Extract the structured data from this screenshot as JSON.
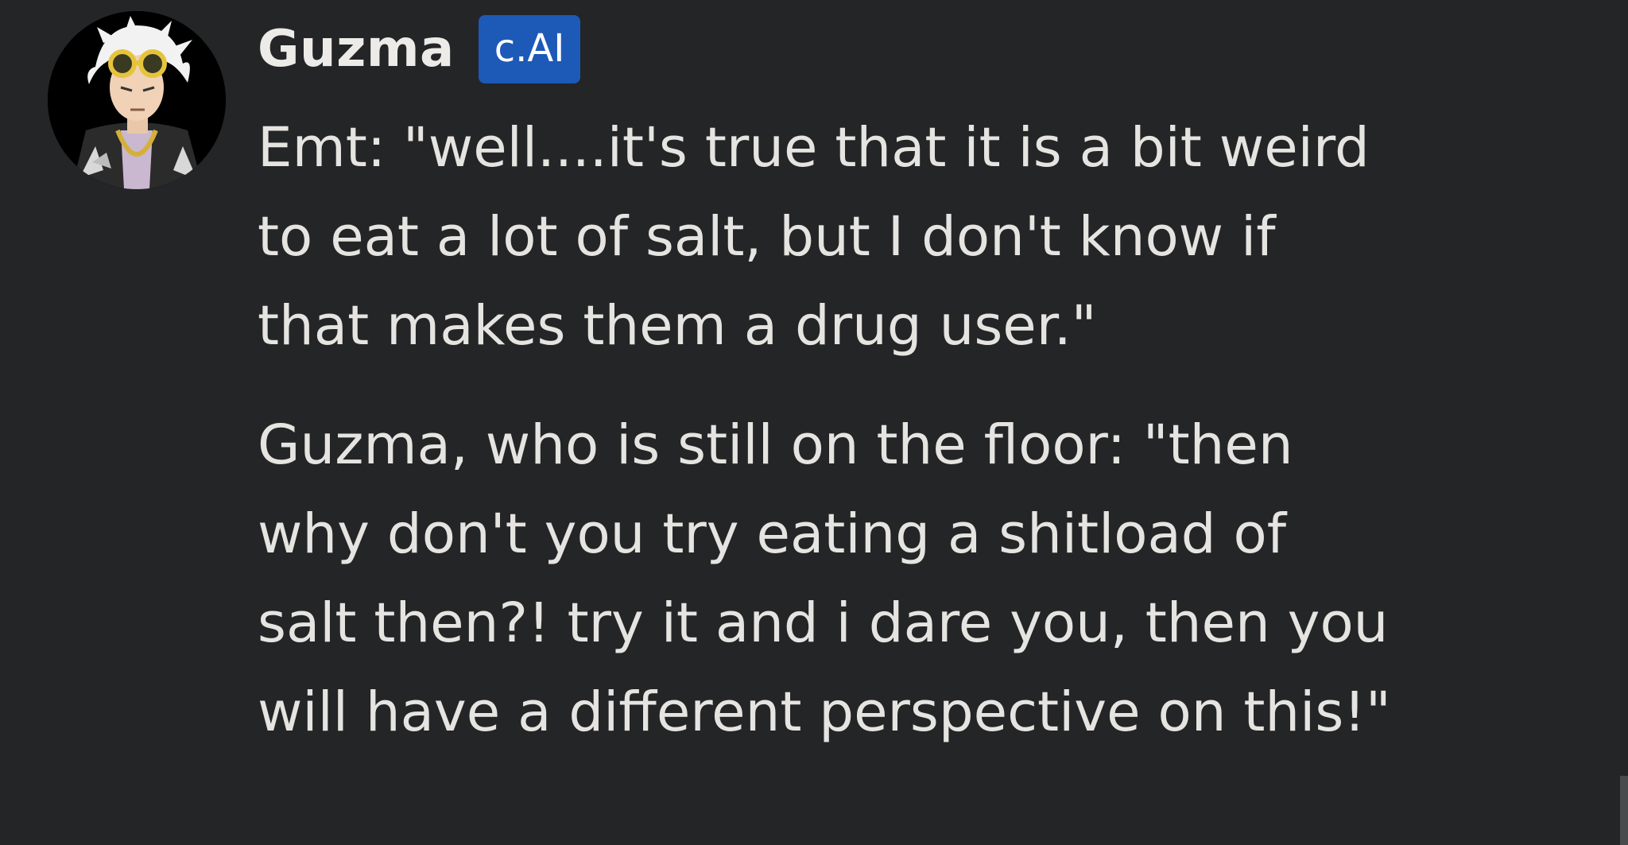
{
  "message": {
    "author": "Guzma",
    "badge": "c.AI",
    "avatar_icon": "guzma-avatar",
    "paragraphs": [
      "Emt: \"well....it's true that it is a bit weird\nto eat a lot of salt, but I don't know if\nthat makes them a drug user.\"",
      "Guzma, who is still on the floor: \"then\nwhy don't you try eating a shitload of\nsalt then?! try it and i dare you, then you\nwill have a different perspective on this!\""
    ]
  },
  "colors": {
    "background": "#242526",
    "text": "#e6e4e1",
    "badge_bg": "#1d59b7"
  }
}
